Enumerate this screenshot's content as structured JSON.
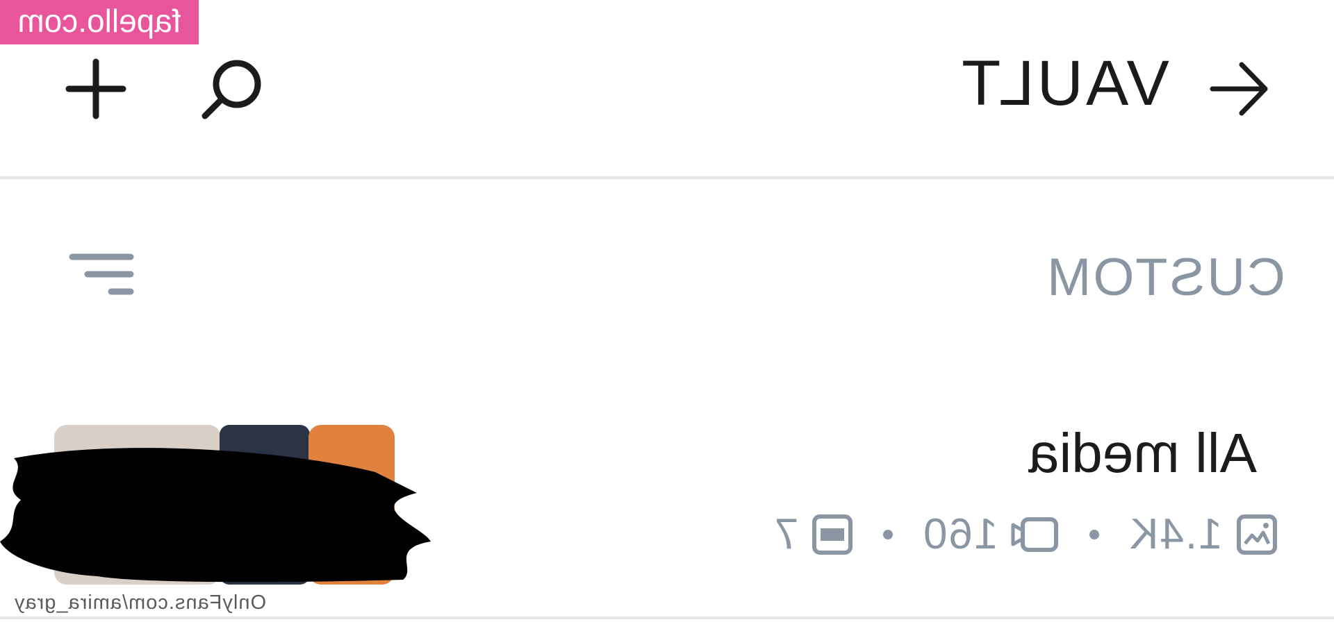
{
  "watermark": {
    "text": "fapello.com",
    "color": "#e8559b"
  },
  "header": {
    "title": "VAULT",
    "icons": {
      "add": "plus-icon",
      "search": "search-icon",
      "back": "arrow-right-icon"
    }
  },
  "filter_bar": {
    "label": "CUSTOM",
    "icon": "filter-lines-icon"
  },
  "list": {
    "items": [
      {
        "title": "All media",
        "stats": [
          {
            "icon": "image-icon",
            "value": "1.4K"
          },
          {
            "icon": "video-icon",
            "value": "160"
          },
          {
            "icon": "gif-icon",
            "value": "7"
          }
        ]
      }
    ]
  },
  "credit": "OnlyFans.com/amira_gray",
  "colors": {
    "accent_gray": "#8a96a3",
    "text": "#1b1b1b",
    "divider": "#e4e6e8"
  }
}
